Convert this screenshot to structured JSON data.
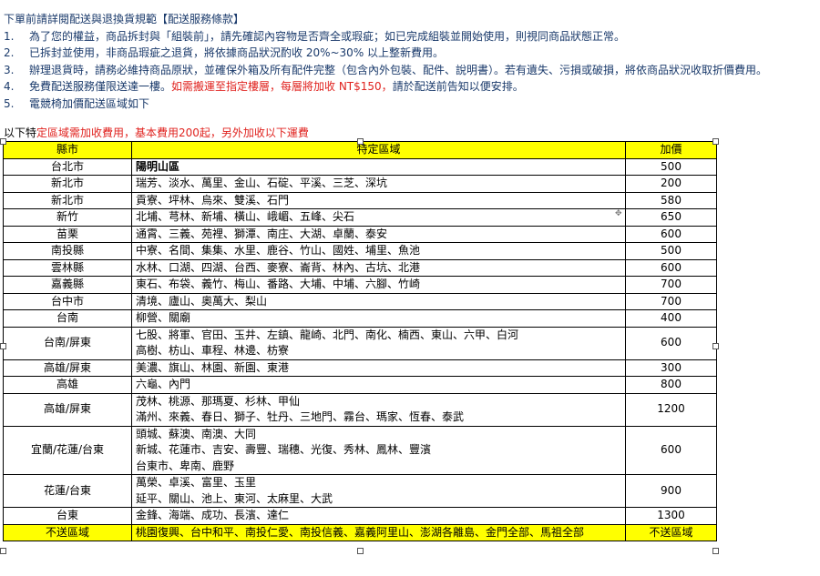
{
  "notice": {
    "title": "下單前請詳閱配送與退換貨規範【配送服務條款】",
    "items": [
      {
        "num": "1.",
        "text": "為了您的權益，商品拆封與「組裝前」，請先確認內容物是否齊全或瑕疵；如已完成組裝並開始使用，則視同商品狀態正常。"
      },
      {
        "num": "2.",
        "text": "已拆封並使用，非商品瑕疵之退貨，將依據商品狀況酌收 20%~30% 以上整新費用。"
      },
      {
        "num": "3.",
        "text": "辦理退貨時，請務必維持商品原狀，並確保外箱及所有配件完整（包含內外包裝、配件、說明書）。若有遺失、污損或破損，將依商品狀況收取折價費用。"
      },
      {
        "num": "4.",
        "text": "免費配送服務僅限送達一樓。",
        "red": "如需搬運至指定樓層，每層將加收 NT$150，",
        "tail": "請於配送前告知以便安排。"
      },
      {
        "num": "5.",
        "text": "電競椅加價配送區域如下"
      }
    ]
  },
  "subtitle": {
    "prefix": "以下特",
    "red": "定區域需加收費用，基本費用200起，另外加收以下運費"
  },
  "table": {
    "headers": [
      "縣市",
      "特定區域",
      "加價"
    ],
    "rows": [
      {
        "county": "台北市",
        "areas": [
          "陽明山區"
        ],
        "price": "500"
      },
      {
        "county": "新北市",
        "areas": [
          "瑞芳、淡水、萬里、金山、石碇、平溪、三芝、深坑"
        ],
        "price": "200"
      },
      {
        "county": "新北市",
        "areas": [
          "貢寮、坪林、烏來、雙溪、石門"
        ],
        "price": "580"
      },
      {
        "county": "新竹",
        "areas": [
          "北埔、芎林、新埔、橫山、峨嵋、五峰、尖石"
        ],
        "price": "650"
      },
      {
        "county": "苗栗",
        "areas": [
          "通霄、三義、苑裡、獅潭、南庄、大湖、卓蘭、泰安"
        ],
        "price": "600"
      },
      {
        "county": "南投縣",
        "areas": [
          "中寮、名間、集集、水里、鹿谷、竹山、國姓、埔里、魚池"
        ],
        "price": "500"
      },
      {
        "county": "雲林縣",
        "areas": [
          "水林、口湖、四湖、台西、麥寮、崙背、林內、古坑、北港"
        ],
        "price": "600"
      },
      {
        "county": "嘉義縣",
        "areas": [
          "東石、布袋、義竹、梅山、番路、大埔、中埔、六腳、竹崎"
        ],
        "price": "700"
      },
      {
        "county": "台中市",
        "areas": [
          "清境、廬山、奧萬大、梨山"
        ],
        "price": "700"
      },
      {
        "county": "台南",
        "areas": [
          "柳營、關廟"
        ],
        "price": "400"
      },
      {
        "county": "台南/屏東",
        "areas": [
          "七股、將軍、官田、玉井、左鎮、龍崎、北門、南化、楠西、東山、六甲、白河",
          "高樹、枋山、車程、林邊、枋寮"
        ],
        "price": "600"
      },
      {
        "county": "高雄/屏東",
        "areas": [
          "美濃、旗山、林園、新園、東港"
        ],
        "price": "300"
      },
      {
        "county": "高雄",
        "areas": [
          "六龜、內門"
        ],
        "price": "800"
      },
      {
        "county": "高雄/屏東",
        "areas": [
          "茂林、桃源、那瑪夏、杉林、甲仙",
          "滿州、來義、春日、獅子、牡丹、三地門、霧台、瑪家、恆春、泰武"
        ],
        "price": "1200"
      },
      {
        "county": "宜蘭/花蓮/台東",
        "areas": [
          "頭城、蘇澳、南澳、大同",
          "新城、花蓮市、吉安、壽豐、瑞穗、光復、秀林、鳳林、豐濱",
          "台東市、卑南、鹿野"
        ],
        "price": "600"
      },
      {
        "county": "花蓮/台東",
        "areas": [
          "萬榮、卓溪、富里、玉里",
          "延平、關山、池上、東河、太麻里、大武"
        ],
        "price": "900"
      },
      {
        "county": "台東",
        "areas": [
          "金鋒、海端、成功、長濱、達仁"
        ],
        "price": "1300"
      }
    ],
    "exclude": {
      "county": "不送區域",
      "areas": "桃園復興、台中和平、南投仁愛、南投信義、嘉義阿里山、澎湖各離島、金門全部、馬祖全部",
      "price": "不送區域"
    }
  }
}
